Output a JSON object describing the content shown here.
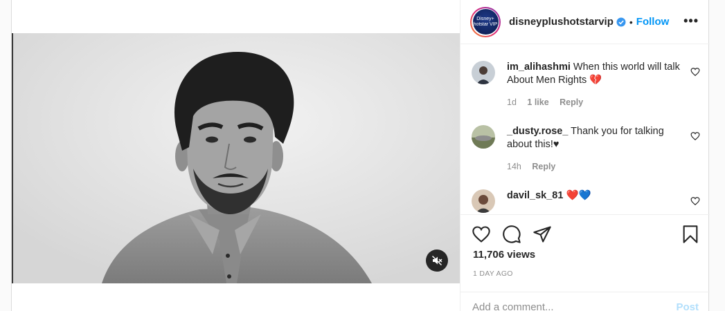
{
  "header": {
    "username": "disneyplushotstarvip",
    "separator": "•",
    "follow_label": "Follow",
    "more_label": "•••",
    "avatar_text": "Disney+ hotstar VIP"
  },
  "comments": [
    {
      "username": "im_alihashmi",
      "text": "When this world will talk About Men Rights",
      "emoji": "💔",
      "time": "1d",
      "likes": "1 like",
      "reply": "Reply"
    },
    {
      "username": "_dusty.rose_",
      "text": "Thank you for talking about this!♥",
      "emoji": "",
      "time": "14h",
      "likes": "",
      "reply": "Reply"
    },
    {
      "username": "davil_sk_81",
      "text": "",
      "emoji": "❤️💙",
      "time": "",
      "likes": "",
      "reply": ""
    }
  ],
  "stats": {
    "views": "11,706 views",
    "date": "1 DAY AGO"
  },
  "add_comment": {
    "placeholder": "Add a comment...",
    "post_label": "Post"
  },
  "colors": {
    "accent": "#0095f6",
    "post_disabled": "#b2dffc",
    "muted_text": "#8e8e8e",
    "border": "#efefef"
  },
  "icons": [
    "chevron-down-icon",
    "verified-badge-icon",
    "more-options-icon",
    "heart-icon",
    "comment-icon",
    "share-icon",
    "bookmark-icon",
    "mute-icon"
  ]
}
